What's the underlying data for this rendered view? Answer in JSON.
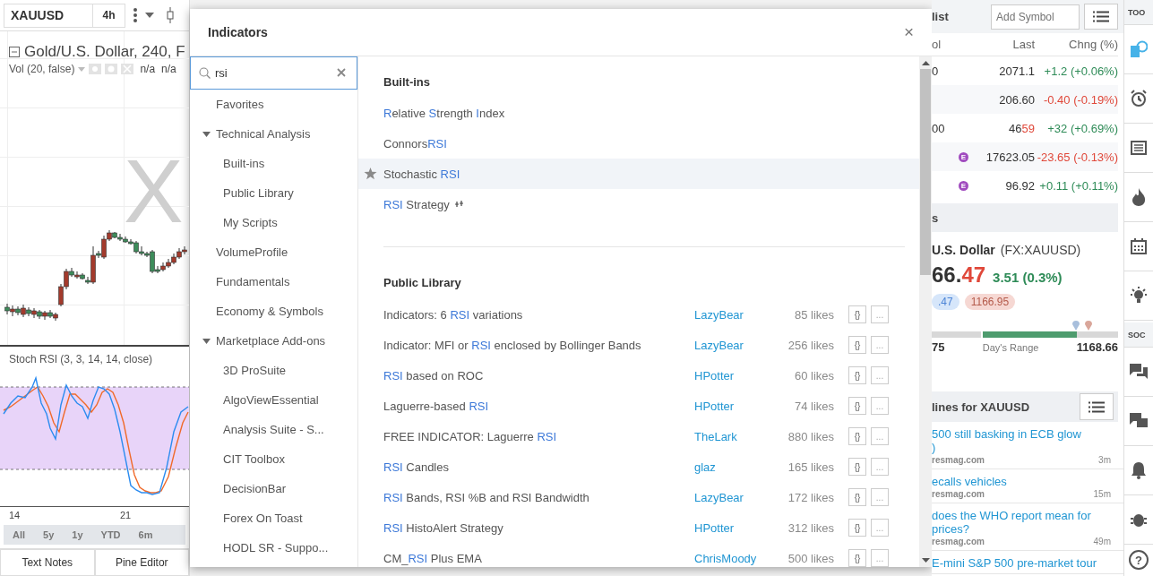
{
  "chart": {
    "symbol": "XAUUSD",
    "interval": "4h",
    "title": "Gold/U.S. Dollar, 240, F",
    "watermark": "X",
    "volume_legend": {
      "label": "Vol (20, false)",
      "values": [
        "n/a",
        "n/a"
      ]
    },
    "oscillator_legend": "Stoch RSI (3, 3, 14, 14, close)",
    "dates": [
      "14",
      "21"
    ],
    "ranges": [
      {
        "label": "All"
      },
      {
        "label": "5y"
      },
      {
        "label": "1y"
      },
      {
        "label": "YTD"
      },
      {
        "label": "6m"
      }
    ],
    "bottom_tabs": [
      "Text Notes",
      "Pine Editor"
    ]
  },
  "dialog": {
    "title": "Indicators",
    "close": "×",
    "search": {
      "value": "rsi"
    },
    "sidebar": [
      {
        "label": "Favorites"
      },
      {
        "label": "Technical Analysis",
        "expanded": true,
        "children": [
          {
            "label": "Built-ins"
          },
          {
            "label": "Public Library"
          },
          {
            "label": "My Scripts"
          }
        ]
      },
      {
        "label": "VolumeProfile"
      },
      {
        "label": "Fundamentals"
      },
      {
        "label": "Economy & Symbols"
      },
      {
        "label": "Marketplace Add-ons",
        "expanded": true,
        "children": [
          {
            "label": "3D ProSuite"
          },
          {
            "label": "AlgoViewEssential"
          },
          {
            "label": "Analysis Suite - S..."
          },
          {
            "label": "CIT Toolbox"
          },
          {
            "label": "DecisionBar"
          },
          {
            "label": "Forex On Toast"
          },
          {
            "label": "HODL SR - Suppo..."
          }
        ]
      }
    ],
    "builtins": {
      "heading": "Built-ins",
      "items": [
        {
          "highlighted": false,
          "parts": [
            {
              "text": "R",
              "match": true
            },
            {
              "text": "elative ",
              "match": false
            },
            {
              "text": "S",
              "match": true
            },
            {
              "text": "trength ",
              "match": false
            },
            {
              "text": "I",
              "match": true
            },
            {
              "text": "ndex",
              "match": false
            }
          ]
        },
        {
          "highlighted": false,
          "parts": [
            {
              "text": "Connors",
              "match": false
            },
            {
              "text": "RSI",
              "match": true
            }
          ]
        },
        {
          "highlighted": true,
          "parts": [
            {
              "text": "Stochastic ",
              "match": false
            },
            {
              "text": "RSI",
              "match": true
            }
          ]
        },
        {
          "highlighted": false,
          "strategy": true,
          "parts": [
            {
              "text": "RSI",
              "match": true
            },
            {
              "text": " Strategy",
              "match": false
            }
          ]
        }
      ]
    },
    "library": {
      "heading": "Public Library",
      "rows": [
        {
          "parts": [
            {
              "text": "Indicators: 6 ",
              "match": false
            },
            {
              "text": "RSI",
              "match": true
            },
            {
              "text": " variations",
              "match": false
            }
          ],
          "author": "LazyBear",
          "likes": "85 likes",
          "source_button": "{}",
          "more_button": "..."
        },
        {
          "parts": [
            {
              "text": "Indicator: MFI or ",
              "match": false
            },
            {
              "text": "RSI",
              "match": true
            },
            {
              "text": " enclosed by Bollinger Bands",
              "match": false
            }
          ],
          "author": "LazyBear",
          "likes": "256 likes",
          "source_button": "{}",
          "more_button": "..."
        },
        {
          "parts": [
            {
              "text": "RSI",
              "match": true
            },
            {
              "text": " based on ROC",
              "match": false
            }
          ],
          "author": "HPotter",
          "likes": "60 likes",
          "source_button": "{}",
          "more_button": "..."
        },
        {
          "parts": [
            {
              "text": "Laguerre-based ",
              "match": false
            },
            {
              "text": "RSI",
              "match": true
            }
          ],
          "author": "HPotter",
          "likes": "74 likes",
          "source_button": "{}",
          "more_button": "..."
        },
        {
          "parts": [
            {
              "text": "FREE INDICATOR: Laguerre ",
              "match": false
            },
            {
              "text": "RSI",
              "match": true
            }
          ],
          "author": "TheLark",
          "likes": "880 likes",
          "source_button": "{}",
          "more_button": "..."
        },
        {
          "parts": [
            {
              "text": "RSI",
              "match": true
            },
            {
              "text": " Candles",
              "match": false
            }
          ],
          "author": "glaz",
          "likes": "165 likes",
          "source_button": "{}",
          "more_button": "..."
        },
        {
          "parts": [
            {
              "text": "RSI",
              "match": true
            },
            {
              "text": " Bands, RSI %B and RSI Bandwidth",
              "match": false
            }
          ],
          "author": "LazyBear",
          "likes": "172 likes",
          "source_button": "{}",
          "more_button": "..."
        },
        {
          "parts": [
            {
              "text": "RSI",
              "match": true
            },
            {
              "text": " HistoAlert Strategy",
              "match": false
            }
          ],
          "author": "HPotter",
          "likes": "312 likes",
          "source_button": "{}",
          "more_button": "..."
        },
        {
          "parts": [
            {
              "text": "CM_",
              "match": false
            },
            {
              "text": "RSI",
              "match": true
            },
            {
              "text": " Plus EMA",
              "match": false
            }
          ],
          "author": "ChrisMoody",
          "likes": "500 likes",
          "source_button": "{}",
          "more_button": "..."
        }
      ]
    }
  },
  "watchlist": {
    "title": "list",
    "add_symbol": {
      "placeholder": "Add Symbol"
    },
    "columns": [
      "ol",
      "Last",
      "Chng (%)"
    ],
    "rows": [
      {
        "symbol": "0",
        "last": "2071.1",
        "change": "+1.2 (+0.06%)",
        "positive": true
      },
      {
        "last": "206.60",
        "change": "-0.40 (-0.19%)",
        "positive": false
      },
      {
        "symbol": "00",
        "last": "46",
        "last_tick": "59",
        "change": "+32 (+0.69%)",
        "positive": true
      },
      {
        "badge": "E",
        "last": "17623.05",
        "change": "-23.65 (-0.13%)",
        "positive": false
      },
      {
        "badge": "E",
        "last": "96.92",
        "change": "+0.11 (+0.11%)",
        "positive": true
      }
    ]
  },
  "details": {
    "title": "s",
    "name": "U.S. Dollar",
    "ticker": "(FX:XAUUSD)",
    "price": "66.",
    "price_tick": "47",
    "change": "3.51 (0.3%)",
    "bid": ".47",
    "ask": "1166.95",
    "range": {
      "low": "75",
      "label": "Day's Range",
      "high": "1168.66",
      "level": 0.78
    }
  },
  "headlines": {
    "title": "lines for XAUUSD",
    "items": [
      {
        "title": "500 still basking in ECB glow",
        "title_2": ")",
        "source": "resmag.com",
        "age": "3m"
      },
      {
        "title": "ecalls vehicles",
        "source": "resmag.com",
        "age": "15m"
      },
      {
        "title": "does the WHO report mean for",
        "title_2": "prices?",
        "source": "resmag.com",
        "age": "49m"
      },
      {
        "title": "E-mini S&P 500 pre-market tour"
      }
    ]
  },
  "toolbar": {
    "top_label": "TOO",
    "social_label": "SOC",
    "help": "?"
  }
}
